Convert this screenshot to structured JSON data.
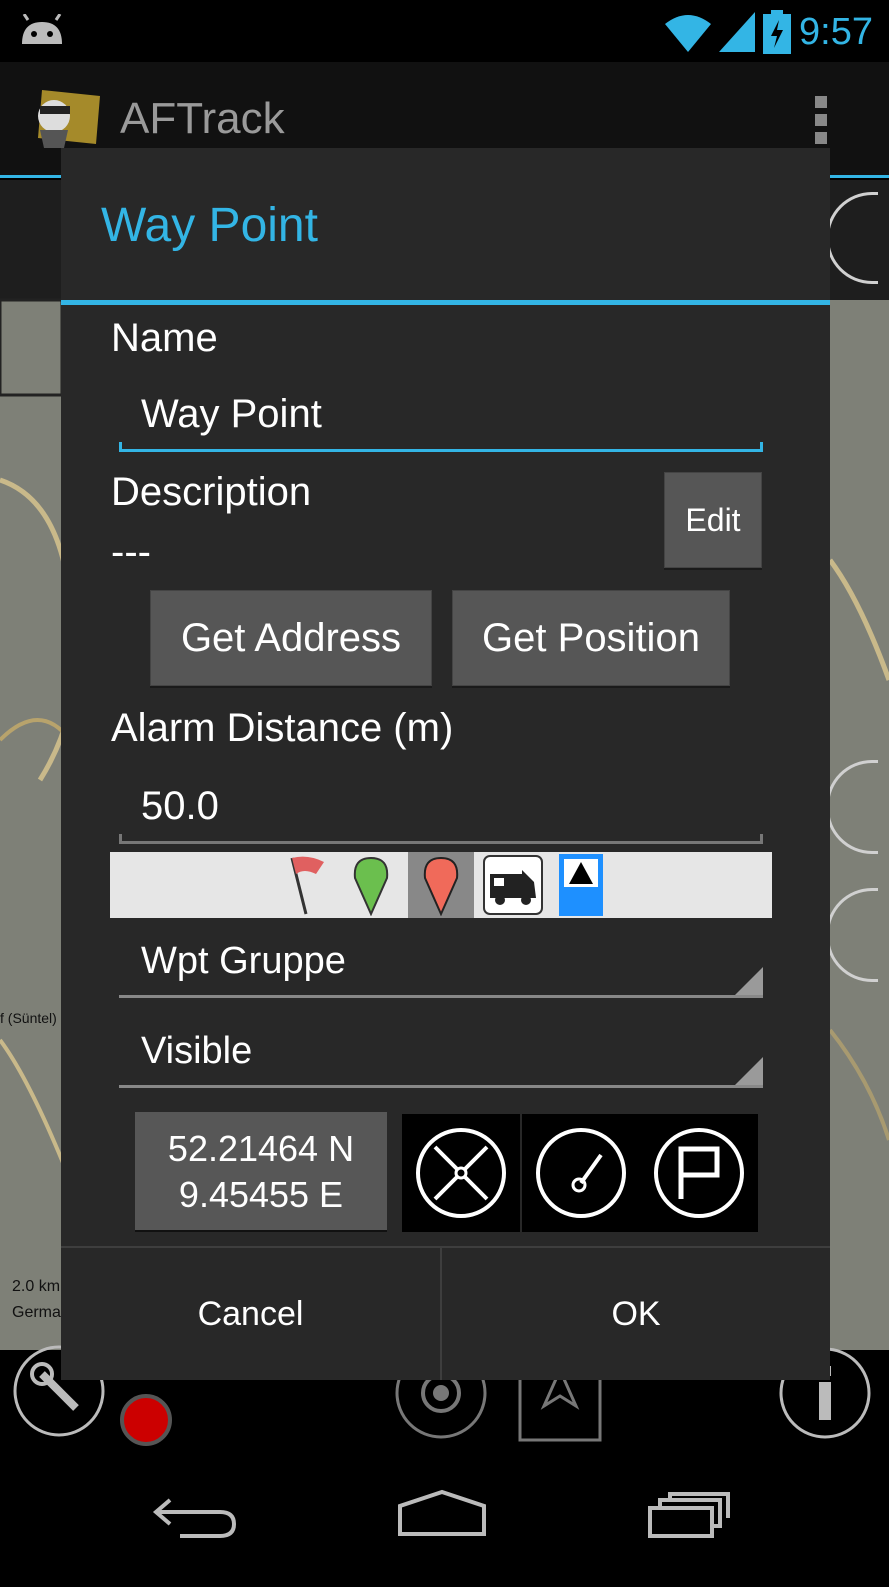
{
  "status_bar": {
    "time": "9:57"
  },
  "app": {
    "title": "AFTrack"
  },
  "dialog": {
    "title": "Way Point",
    "name_label": "Name",
    "name_value": "Way Point",
    "description_label": "Description",
    "description_value": "---",
    "edit_button": "Edit",
    "get_address_button": "Get Address",
    "get_position_button": "Get Position",
    "alarm_label": "Alarm Distance (m)",
    "alarm_value": "50.0",
    "group_select": "Wpt Gruppe",
    "visibility_select": "Visible",
    "latitude": "52.21464 N",
    "longitude": "9.45455 E",
    "cancel_button": "Cancel",
    "ok_button": "OK",
    "selected_icon": "red-pin"
  },
  "map": {
    "place_label": "f (Süntel)",
    "scale_label": "2.0 km",
    "country_label": "Germa"
  },
  "colors": {
    "accent": "#33b5e5",
    "dialog_bg": "#282828",
    "button_bg": "#565656"
  }
}
